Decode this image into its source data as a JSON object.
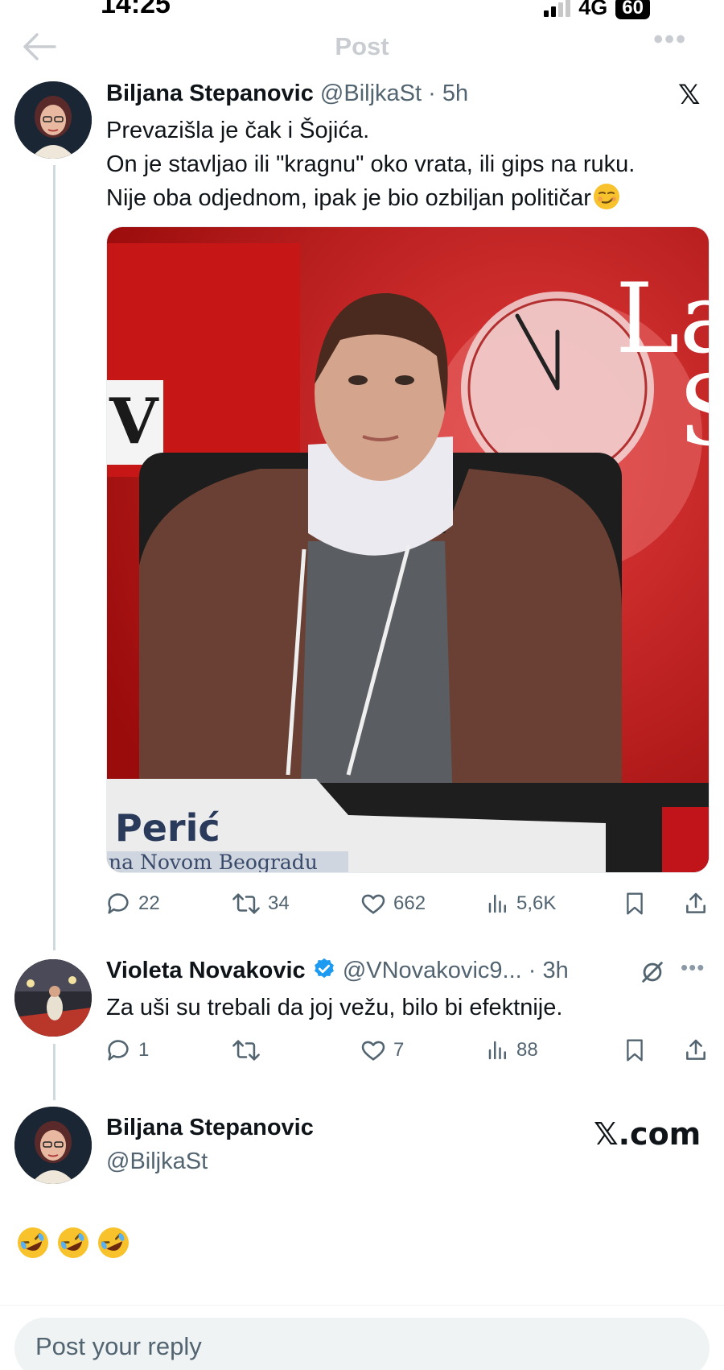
{
  "status_bar": {
    "time": "14:25",
    "network": "4G",
    "battery": "60"
  },
  "nav": {
    "title": "Post"
  },
  "tweet": {
    "name": "Biljana Stepanovic",
    "handle": "@BiljkaSt",
    "time": "5h",
    "lines": [
      "Prevazišla je čak i Šojića.",
      "On je stavljao ili \"kragnu\" oko vrata, ili gips na ruku.",
      "Nije oba odjednom, ipak je bio ozbiljan političar"
    ],
    "image": {
      "lower_third_name": "Perić",
      "lower_third_sub": "na Novom Beogradu",
      "backdrop_letters": [
        "V",
        "La",
        "S"
      ]
    },
    "stats": {
      "replies": "22",
      "reposts": "34",
      "likes": "662",
      "views": "5,6K"
    }
  },
  "reply": {
    "name": "Violeta Novakovic",
    "handle": "@VNovakovic9...",
    "time": "3h",
    "text": "Za uši su trebali da joj vežu, bilo bi efektnije.",
    "stats": {
      "replies": "1",
      "reposts": "",
      "likes": "7",
      "views": "88"
    }
  },
  "embed": {
    "name": "Biljana Stepanovic",
    "handle": "@BiljkaSt",
    "brand": "𝕏.com",
    "emojis": 3
  },
  "composer": {
    "placeholder": "Post your reply"
  },
  "colors": {
    "text": "#0f1419",
    "muted": "#536471",
    "verified": "#1d9bf0",
    "line": "#cfd9de"
  }
}
